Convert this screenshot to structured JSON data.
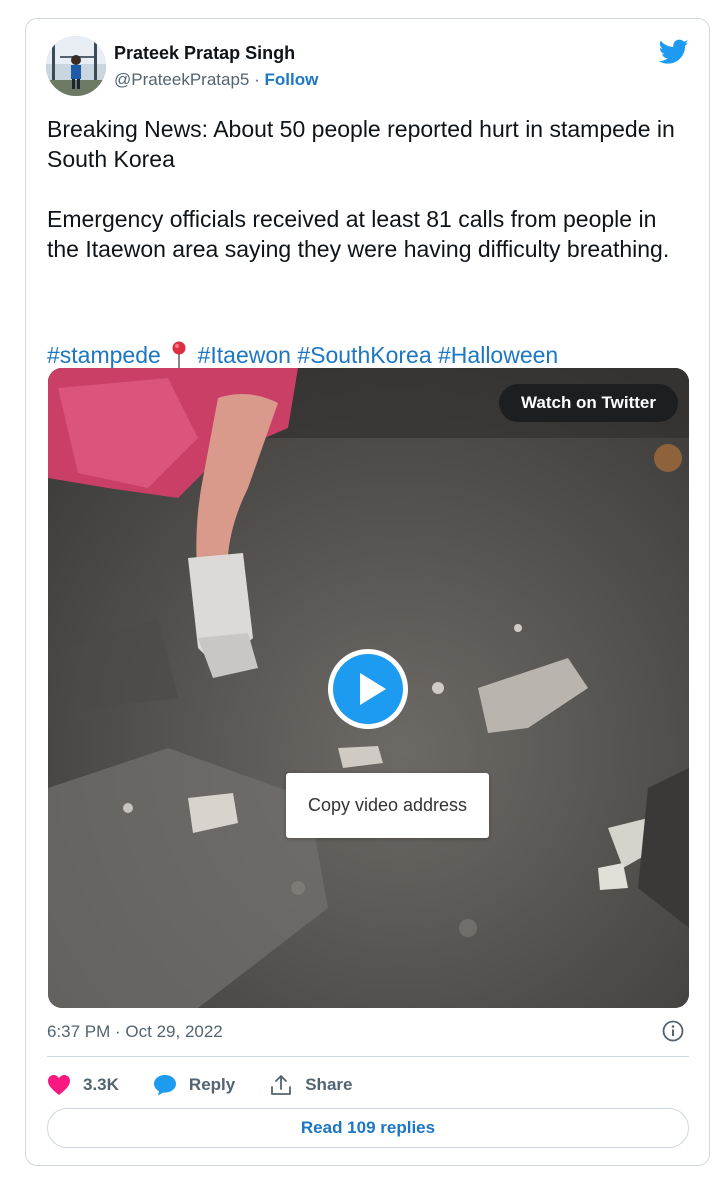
{
  "author": {
    "name": "Prateek Pratap Singh",
    "handle": "@PrateekPratap5",
    "separator": "·",
    "follow_label": "Follow"
  },
  "tweet": {
    "paragraph1": "Breaking News: About 50 people reported hurt in stampede in South Korea",
    "paragraph2": "Emergency officials received at least 81 calls from people in the Itaewon area saying they were having difficulty breathing.",
    "hashtags": [
      "#stampede",
      "#Itaewon",
      "#SouthKorea",
      "#Halloween"
    ],
    "pin_emoji": "round-pushpin-icon"
  },
  "video": {
    "watch_label": "Watch on Twitter",
    "context_menu_item": "Copy video address"
  },
  "meta": {
    "timestamp": "6:37 PM · Oct 29, 2022"
  },
  "actions": {
    "like_count": "3.3K",
    "reply_label": "Reply",
    "share_label": "Share",
    "read_replies_label": "Read 109 replies"
  },
  "colors": {
    "link": "#1d77c2",
    "twitter_blue": "#1d9bf0",
    "like_pink": "#f91880",
    "secondary_text": "#536471",
    "border": "#cfd9de"
  }
}
